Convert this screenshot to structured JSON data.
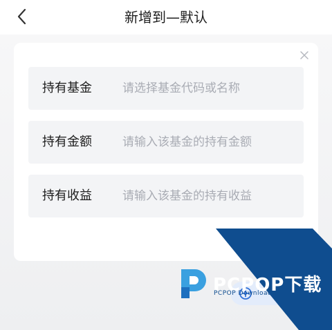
{
  "header": {
    "title": "新增到—默认",
    "back_icon": "chevron-left-icon"
  },
  "form": {
    "close_icon": "close-icon",
    "fields": [
      {
        "label": "持有基金",
        "placeholder": "请选择基金代码或名称"
      },
      {
        "label": "持有金额",
        "placeholder": "请输入该基金的持有金额"
      },
      {
        "label": "持有收益",
        "placeholder": "请输入该基金的持有收益"
      }
    ]
  },
  "add_button": {
    "icon": "plus-circle-icon"
  },
  "watermark": {
    "brand": "PCPOP下载",
    "sub": "PCPOP Download",
    "logo_icon": "pcpop-logo-icon",
    "colors": {
      "dark_blue": "#0f4d8f",
      "light_blue": "#3aa0e0"
    }
  },
  "colors": {
    "page_background": "#f2f3f5",
    "field_background": "#f3f4f6",
    "placeholder": "#a9acb4",
    "label": "#1c1c1c"
  }
}
